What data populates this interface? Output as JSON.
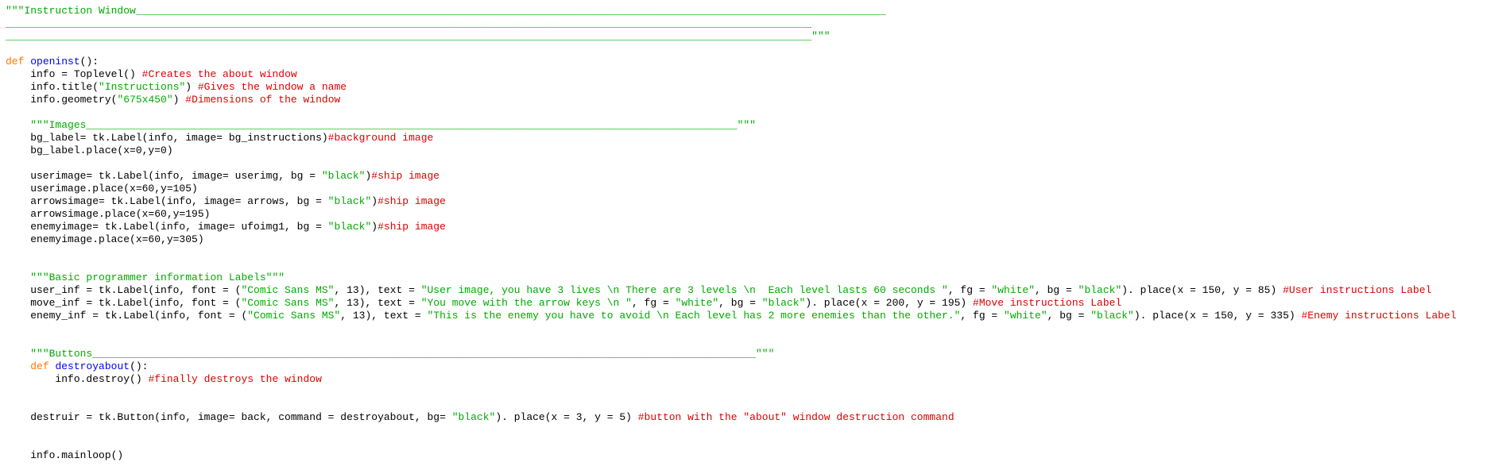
{
  "editor": {
    "colors": {
      "plain": "#000000",
      "keyword": "#ff7700",
      "string": "#00aa00",
      "comment": "#dd0000",
      "definition": "#0000ff",
      "background": "#ffffff"
    },
    "lines": [
      [
        [
          "string",
          "\"\"\"Instruction Window_________________________________________________________________________________________________________________________"
        ]
      ],
      [
        [
          "string",
          "__________________________________________________________________________________________________________________________________"
        ]
      ],
      [
        [
          "string",
          "__________________________________________________________________________________________________________________________________\"\"\""
        ]
      ],
      [],
      [
        [
          "keyword",
          "def "
        ],
        [
          "definition",
          "openinst"
        ],
        [
          "plain",
          "():"
        ]
      ],
      [
        [
          "plain",
          "    info = Toplevel() "
        ],
        [
          "comment",
          "#Creates the about window"
        ]
      ],
      [
        [
          "plain",
          "    info.title("
        ],
        [
          "string",
          "\"Instructions\""
        ],
        [
          "plain",
          ") "
        ],
        [
          "comment",
          "#Gives the window a name"
        ]
      ],
      [
        [
          "plain",
          "    info.geometry("
        ],
        [
          "string",
          "\"675x450\""
        ],
        [
          "plain",
          ") "
        ],
        [
          "comment",
          "#Dimensions of the window"
        ]
      ],
      [],
      [
        [
          "plain",
          "    "
        ],
        [
          "string",
          "\"\"\"Images_________________________________________________________________________________________________________\"\"\""
        ]
      ],
      [
        [
          "plain",
          "    bg_label= tk.Label(info, image= bg_instructions)"
        ],
        [
          "comment",
          "#background image"
        ]
      ],
      [
        [
          "plain",
          "    bg_label.place(x=0,y=0)"
        ]
      ],
      [],
      [
        [
          "plain",
          "    userimage= tk.Label(info, image= userimg, bg = "
        ],
        [
          "string",
          "\"black\""
        ],
        [
          "plain",
          ")"
        ],
        [
          "comment",
          "#ship image"
        ]
      ],
      [
        [
          "plain",
          "    userimage.place(x=60,y=105)"
        ]
      ],
      [
        [
          "plain",
          "    arrowsimage= tk.Label(info, image= arrows, bg = "
        ],
        [
          "string",
          "\"black\""
        ],
        [
          "plain",
          ")"
        ],
        [
          "comment",
          "#ship image"
        ]
      ],
      [
        [
          "plain",
          "    arrowsimage.place(x=60,y=195)"
        ]
      ],
      [
        [
          "plain",
          "    enemyimage= tk.Label(info, image= ufoimg1, bg = "
        ],
        [
          "string",
          "\"black\""
        ],
        [
          "plain",
          ")"
        ],
        [
          "comment",
          "#ship image"
        ]
      ],
      [
        [
          "plain",
          "    enemyimage.place(x=60,y=305)"
        ]
      ],
      [],
      [],
      [
        [
          "plain",
          "    "
        ],
        [
          "string",
          "\"\"\"Basic programmer information Labels\"\"\""
        ]
      ],
      [
        [
          "plain",
          "    user_inf = tk.Label(info, font = ("
        ],
        [
          "string",
          "\"Comic Sans MS\""
        ],
        [
          "plain",
          ", 13), text = "
        ],
        [
          "string",
          "\"User image, you have 3 lives \\n There are 3 levels \\n  Each level lasts 60 seconds \""
        ],
        [
          "plain",
          ", fg = "
        ],
        [
          "string",
          "\"white\""
        ],
        [
          "plain",
          ", bg = "
        ],
        [
          "string",
          "\"black\""
        ],
        [
          "plain",
          "). place(x = 150, y = 85) "
        ],
        [
          "comment",
          "#User instructions Label"
        ]
      ],
      [
        [
          "plain",
          "    move_inf = tk.Label(info, font = ("
        ],
        [
          "string",
          "\"Comic Sans MS\""
        ],
        [
          "plain",
          ", 13), text = "
        ],
        [
          "string",
          "\"You move with the arrow keys \\n \""
        ],
        [
          "plain",
          ", fg = "
        ],
        [
          "string",
          "\"white\""
        ],
        [
          "plain",
          ", bg = "
        ],
        [
          "string",
          "\"black\""
        ],
        [
          "plain",
          "). place(x = 200, y = 195) "
        ],
        [
          "comment",
          "#Move instructions Label"
        ]
      ],
      [
        [
          "plain",
          "    enemy_inf = tk.Label(info, font = ("
        ],
        [
          "string",
          "\"Comic Sans MS\""
        ],
        [
          "plain",
          ", 13), text = "
        ],
        [
          "string",
          "\"This is the enemy you have to avoid \\n Each level has 2 more enemies than the other.\""
        ],
        [
          "plain",
          ", fg = "
        ],
        [
          "string",
          "\"white\""
        ],
        [
          "plain",
          ", bg = "
        ],
        [
          "string",
          "\"black\""
        ],
        [
          "plain",
          "). place(x = 150, y = 335) "
        ],
        [
          "comment",
          "#Enemy instructions Label"
        ]
      ],
      [],
      [],
      [
        [
          "plain",
          "    "
        ],
        [
          "string",
          "\"\"\"Buttons___________________________________________________________________________________________________________\"\"\""
        ]
      ],
      [
        [
          "plain",
          "    "
        ],
        [
          "keyword",
          "def "
        ],
        [
          "definition",
          "destroyabout"
        ],
        [
          "plain",
          "():"
        ]
      ],
      [
        [
          "plain",
          "        info.destroy() "
        ],
        [
          "comment",
          "#finally destroys the window"
        ]
      ],
      [],
      [],
      [
        [
          "plain",
          "    destruir = tk.Button(info, image= back, command = destroyabout, bg= "
        ],
        [
          "string",
          "\"black\""
        ],
        [
          "plain",
          "). place(x = 3, y = 5) "
        ],
        [
          "comment",
          "#button with the \"about\" window destruction command"
        ]
      ],
      [],
      [],
      [
        [
          "plain",
          "    info.mainloop()"
        ]
      ]
    ]
  }
}
